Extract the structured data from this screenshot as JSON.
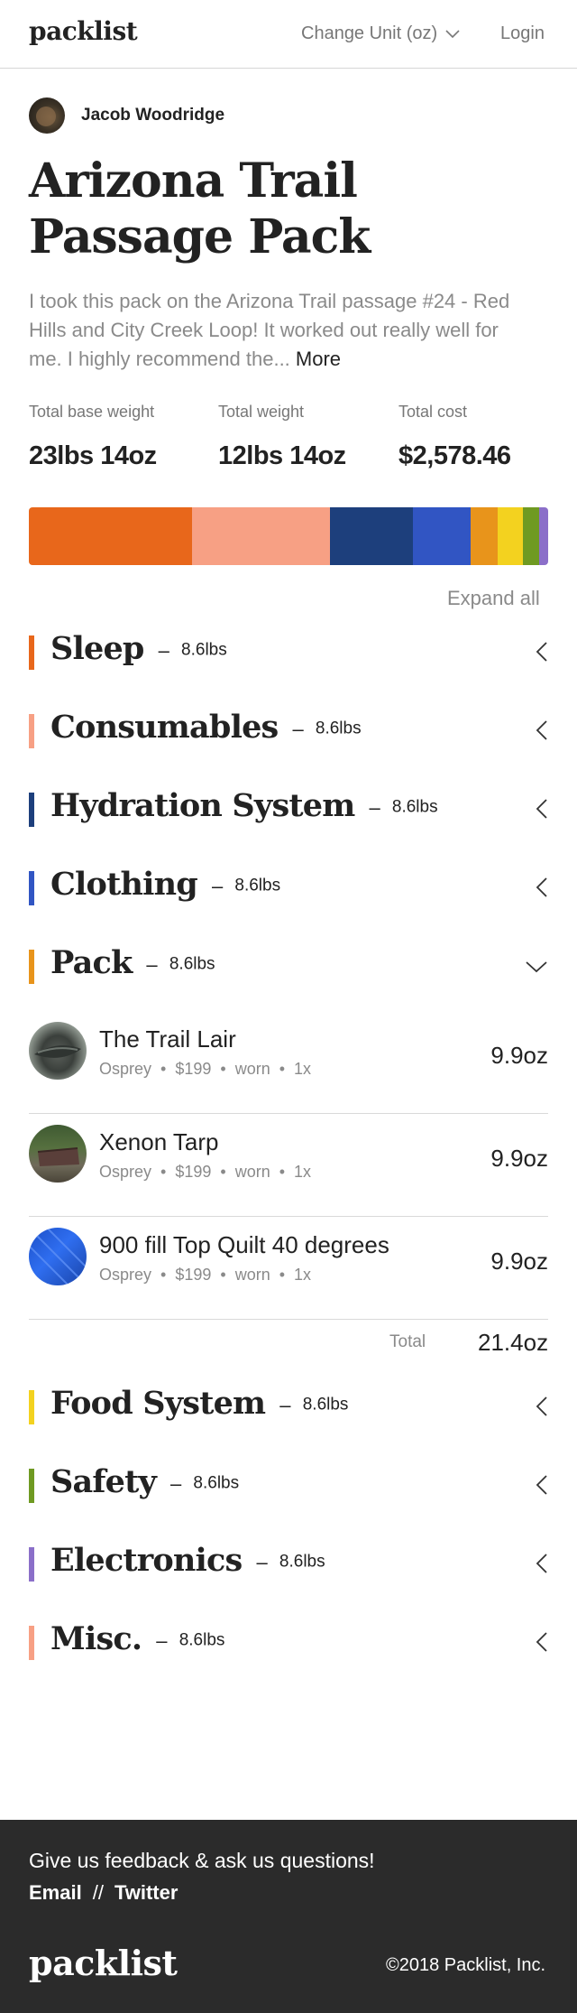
{
  "header": {
    "logo": "packlist",
    "unit_label": "Change Unit (oz)",
    "login_label": "Login"
  },
  "author": {
    "name": "Jacob Woodridge"
  },
  "pack": {
    "title": "Arizona Trail Passage Pack",
    "description": "I took this pack on the Arizona Trail passage #24 - Red Hills and City Creek Loop! It worked out really well for me. I highly recommend the...",
    "more_label": "More"
  },
  "stats": [
    {
      "label": "Total base weight",
      "value": "23lbs 14oz"
    },
    {
      "label": "Total weight",
      "value": "12lbs 14oz"
    },
    {
      "label": "Total cost",
      "value": "$2,578.46"
    }
  ],
  "weight_bar": [
    {
      "category": "Sleep",
      "color": "#e8671b",
      "share": 0.315
    },
    {
      "category": "Consumables",
      "color": "#f7a084",
      "share": 0.264
    },
    {
      "category": "Hydration System",
      "color": "#1d3f7c",
      "share": 0.16
    },
    {
      "category": "Clothing",
      "color": "#3155c3",
      "share": 0.111
    },
    {
      "category": "Pack",
      "color": "#e8941b",
      "share": 0.052
    },
    {
      "category": "Food System",
      "color": "#f3d21f",
      "share": 0.05
    },
    {
      "category": "Safety",
      "color": "#6f9a22",
      "share": 0.031
    },
    {
      "category": "Electronics",
      "color": "#8b6fc9",
      "share": 0.017
    }
  ],
  "expand_label": "Expand all",
  "categories": [
    {
      "name": "Sleep",
      "weight": "8.6lbs",
      "color": "#e8671b",
      "expanded": false
    },
    {
      "name": "Consumables",
      "weight": "8.6lbs",
      "color": "#f7a084",
      "expanded": false
    },
    {
      "name": "Hydration System",
      "weight": "8.6lbs",
      "color": "#1d3f7c",
      "expanded": false
    },
    {
      "name": "Clothing",
      "weight": "8.6lbs",
      "color": "#3155c3",
      "expanded": false
    },
    {
      "name": "Pack",
      "weight": "8.6lbs",
      "color": "#e8941b",
      "expanded": true
    },
    {
      "name": "Food System",
      "weight": "8.6lbs",
      "color": "#f3d21f",
      "expanded": false
    },
    {
      "name": "Safety",
      "weight": "8.6lbs",
      "color": "#6f9a22",
      "expanded": false
    },
    {
      "name": "Electronics",
      "weight": "8.6lbs",
      "color": "#8b6fc9",
      "expanded": false
    },
    {
      "name": "Misc.",
      "weight": "8.6lbs",
      "color": "#f7a084",
      "expanded": false
    }
  ],
  "dash": "–",
  "pack_items": [
    {
      "name": "The Trail Lair",
      "brand": "Osprey",
      "price": "$199",
      "status": "worn",
      "qty": "1x",
      "weight": "9.9oz"
    },
    {
      "name": "Xenon Tarp",
      "brand": "Osprey",
      "price": "$199",
      "status": "worn",
      "qty": "1x",
      "weight": "9.9oz"
    },
    {
      "name": "900 fill Top Quilt 40 degrees",
      "brand": "Osprey",
      "price": "$199",
      "status": "worn",
      "qty": "1x",
      "weight": "9.9oz"
    }
  ],
  "meta_sep": "•",
  "pack_total": {
    "label": "Total",
    "value": "21.4oz"
  },
  "footer": {
    "feedback": "Give us feedback & ask us questions!",
    "email_label": "Email",
    "slash": "//",
    "twitter_label": "Twitter",
    "logo": "packlist",
    "copyright": "©2018 Packlist, Inc."
  }
}
